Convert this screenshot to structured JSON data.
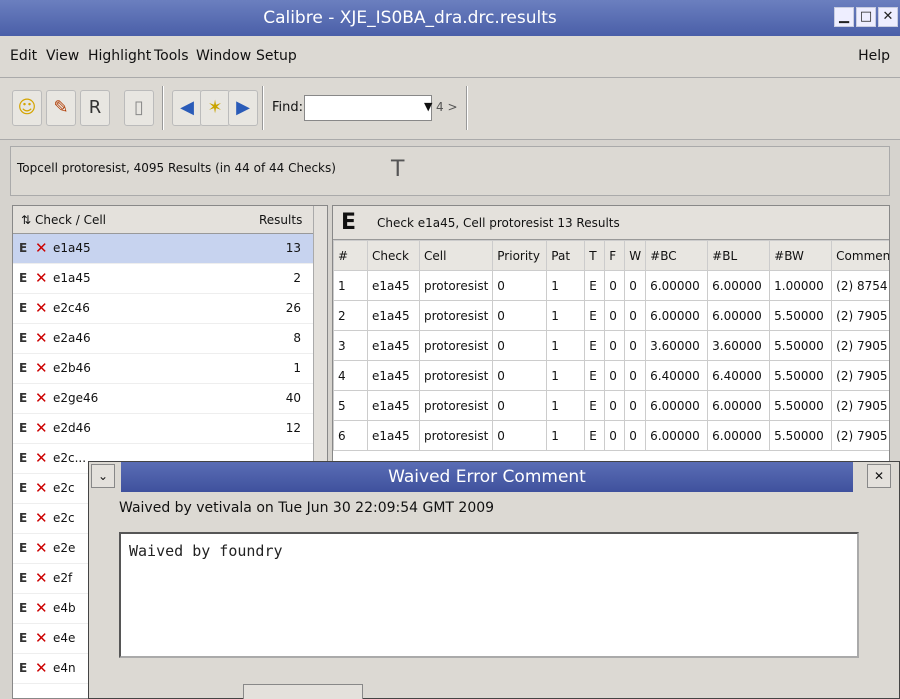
{
  "window": {
    "title": "Calibre - XJE_IS0BA_dra.drc.results"
  },
  "menu": {
    "items": [
      "Edit",
      "View",
      "Highlight",
      "Tools",
      "Window",
      "Setup"
    ],
    "help": "Help"
  },
  "toolbar": {
    "find_label": "Find:",
    "find_value": "",
    "find_nav": "4 >"
  },
  "status": {
    "text": "Topcell protoresist, 4095 Results (in 44 of 44 Checks)"
  },
  "left": {
    "columns": [
      "Check / Cell",
      "Results"
    ],
    "rows": [
      {
        "name": "e1a45",
        "count": "13"
      },
      {
        "name": "e1a45",
        "count": "2"
      },
      {
        "name": "e2c46",
        "count": "26"
      },
      {
        "name": "e2a46",
        "count": "8"
      },
      {
        "name": "e2b46",
        "count": "1"
      },
      {
        "name": "e2ge46",
        "count": "40"
      },
      {
        "name": "e2d46",
        "count": "12"
      },
      {
        "name": "e2c...",
        "count": ""
      },
      {
        "name": "e2c",
        "count": ""
      },
      {
        "name": "e2c",
        "count": ""
      },
      {
        "name": "e2e",
        "count": ""
      },
      {
        "name": "e2f",
        "count": ""
      },
      {
        "name": "e4b",
        "count": ""
      },
      {
        "name": "e4e",
        "count": ""
      },
      {
        "name": "e4n",
        "count": ""
      }
    ]
  },
  "right": {
    "title": "Check e1a45, Cell protoresist 13 Results",
    "columns": [
      "#",
      "Check",
      "Cell",
      "Priority",
      "Pat",
      "T",
      "F",
      "W",
      "#BC",
      "#BL",
      "#BW",
      "Comment"
    ],
    "rows": [
      [
        "1",
        "e1a45",
        "protoresist",
        "0",
        "1",
        "E",
        "0",
        "0",
        "6.00000",
        "6.00000",
        "1.00000",
        "(2) 8754"
      ],
      [
        "2",
        "e1a45",
        "protoresist",
        "0",
        "1",
        "E",
        "0",
        "0",
        "6.00000",
        "6.00000",
        "5.50000",
        "(2) 7905"
      ],
      [
        "3",
        "e1a45",
        "protoresist",
        "0",
        "1",
        "E",
        "0",
        "0",
        "3.60000",
        "3.60000",
        "5.50000",
        "(2) 7905"
      ],
      [
        "4",
        "e1a45",
        "protoresist",
        "0",
        "1",
        "E",
        "0",
        "0",
        "6.40000",
        "6.40000",
        "5.50000",
        "(2) 7905"
      ],
      [
        "5",
        "e1a45",
        "protoresist",
        "0",
        "1",
        "E",
        "0",
        "0",
        "6.00000",
        "6.00000",
        "5.50000",
        "(2) 7905"
      ],
      [
        "6",
        "e1a45",
        "protoresist",
        "0",
        "1",
        "E",
        "0",
        "0",
        "6.00000",
        "6.00000",
        "5.50000",
        "(2) 7905"
      ]
    ]
  },
  "dialog": {
    "title": "Waived Error Comment",
    "waived_by": "Waived by vetivala on Tue Jun 30 22:09:54 GMT 2009",
    "comment": "Waived by foundry"
  }
}
